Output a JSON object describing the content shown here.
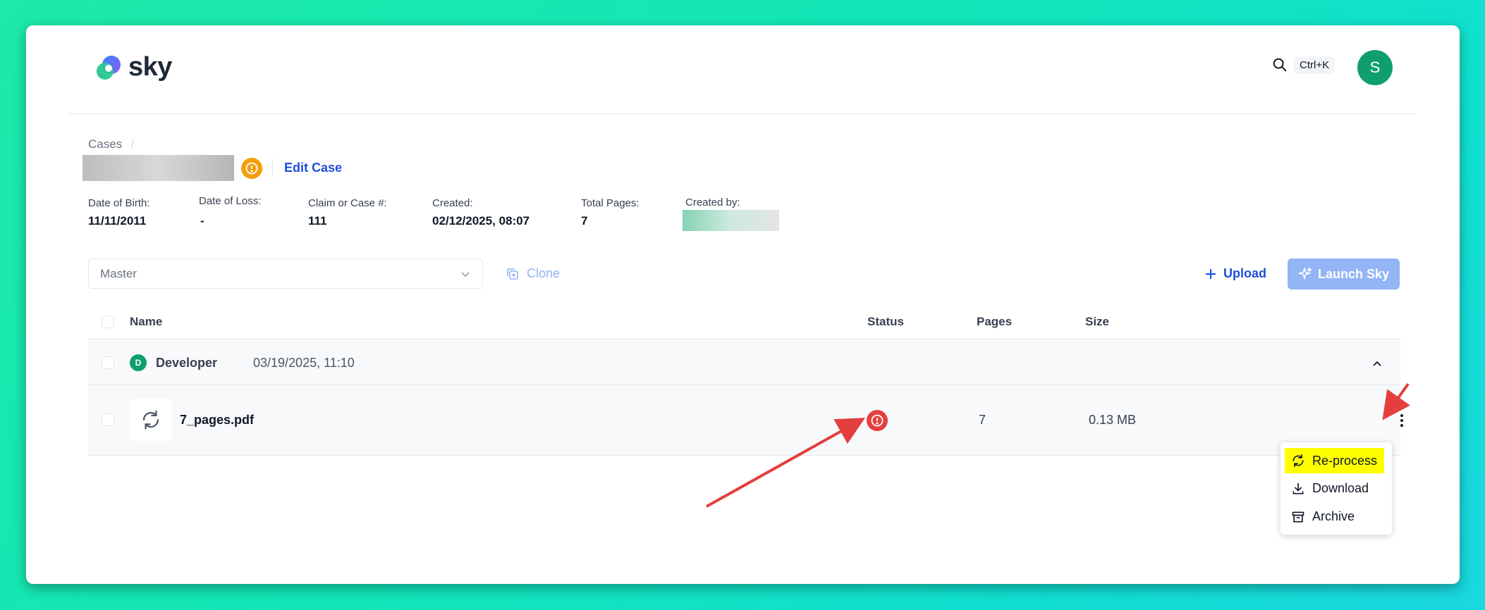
{
  "app": {
    "logo_text": "sky"
  },
  "header": {
    "shortcut": "Ctrl+K",
    "avatar_initial": "S"
  },
  "breadcrumb": {
    "root": "Cases",
    "separator": "/"
  },
  "case": {
    "edit_label": "Edit Case"
  },
  "meta": {
    "dob_label": "Date of Birth:",
    "dob_value": "11/11/2011",
    "dol_label": "Date of Loss:",
    "dol_value": "-",
    "claim_label": "Claim or Case #:",
    "claim_value": "111",
    "created_label": "Created:",
    "created_value": "02/12/2025, 08:07",
    "pages_label": "Total Pages:",
    "pages_value": "7",
    "created_by_label": "Created by:"
  },
  "toolbar": {
    "version_select": "Master",
    "clone_label": "Clone",
    "upload_label": "Upload",
    "launch_label": "Launch Sky"
  },
  "table": {
    "headers": {
      "name": "Name",
      "status": "Status",
      "pages": "Pages",
      "size": "Size"
    },
    "group": {
      "initial": "D",
      "user": "Developer",
      "date": "03/19/2025, 11:10"
    },
    "rows": [
      {
        "name": "7_pages.pdf",
        "pages": "7",
        "size": "0.13 MB"
      }
    ]
  },
  "context_menu": {
    "items": [
      {
        "label": "Re-process",
        "icon": "refresh-icon"
      },
      {
        "label": "Download",
        "icon": "download-icon"
      },
      {
        "label": "Archive",
        "icon": "archive-icon"
      }
    ]
  },
  "colors": {
    "accent": "#1d4ed8",
    "avatar": "#0f9f6e",
    "warning": "#f59e0b",
    "error": "#e53e3e",
    "highlight": "#ffff00",
    "launch_button": "#93b4f5"
  }
}
